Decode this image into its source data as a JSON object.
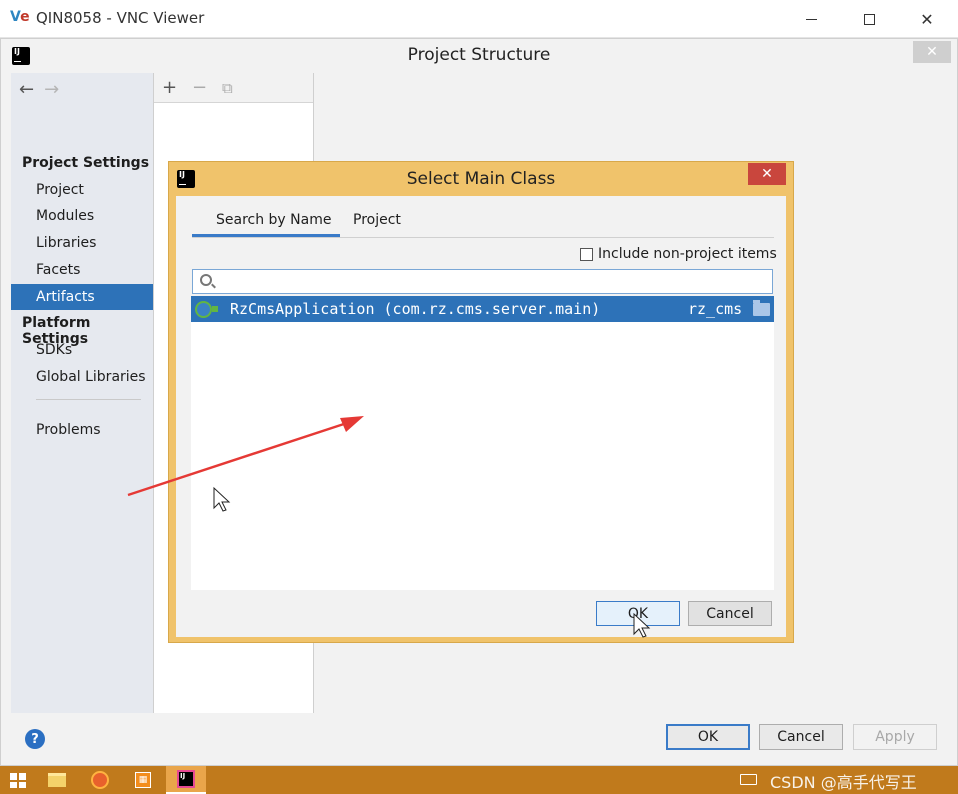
{
  "vnc": {
    "title": "QIN8058 - VNC Viewer",
    "logo_v": "V",
    "logo_e": "e"
  },
  "project_structure": {
    "title": "Project Structure",
    "sidebar": {
      "project_settings_header": "Project Settings",
      "items": [
        {
          "label": "Project"
        },
        {
          "label": "Modules"
        },
        {
          "label": "Libraries"
        },
        {
          "label": "Facets"
        },
        {
          "label": "Artifacts",
          "selected": true
        }
      ],
      "platform_settings_header": "Platform Settings",
      "platform_items": [
        {
          "label": "SDKs"
        },
        {
          "label": "Global Libraries"
        }
      ],
      "problems_label": "Problems"
    },
    "buttons": {
      "ok": "OK",
      "cancel": "Cancel",
      "apply": "Apply"
    },
    "help_label": "?"
  },
  "dialog": {
    "title": "Select Main Class",
    "tabs": [
      {
        "label": "Search by Name",
        "active": true
      },
      {
        "label": "Project",
        "active": false
      }
    ],
    "include_non_project_label": "Include non-project items",
    "include_non_project_checked": false,
    "search": {
      "value": "",
      "placeholder": ""
    },
    "results": [
      {
        "class_name": "RzCmsApplication (com.rz.cms.server.main)",
        "module": "rz_cms",
        "selected": true
      }
    ],
    "buttons": {
      "ok": "OK",
      "cancel": "Cancel"
    }
  },
  "taskbar": {
    "watermark": "CSDN @高手代写王"
  },
  "colors": {
    "selection": "#2d72b8",
    "dialog_frame": "#f0c36b",
    "close_red": "#c9463d",
    "taskbar": "#c07a1c",
    "arrow": "#e53935"
  }
}
